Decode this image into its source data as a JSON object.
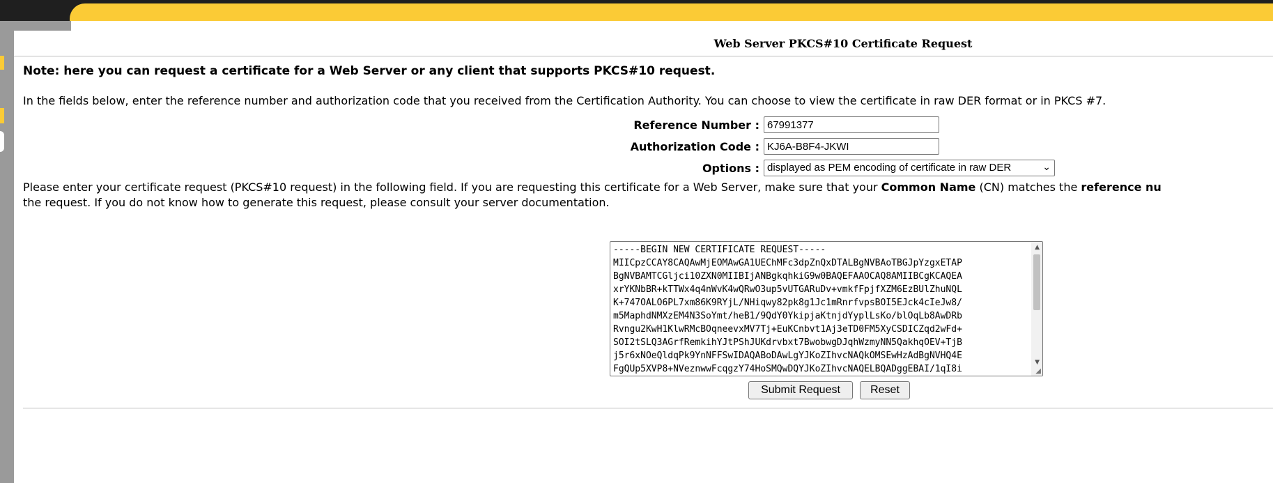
{
  "page": {
    "title": "Web Server PKCS#10 Certificate Request",
    "note": "Note: here you can request a certificate for a Web Server or any client that supports PKCS#10 request.",
    "intro": "In the fields below, enter the reference number and authorization code that you received from the Certification Authority. You can choose to view the certificate in raw DER format or in PKCS #7."
  },
  "form": {
    "reference_label": "Reference Number :",
    "reference_value": "67991377",
    "authorization_label": "Authorization Code :",
    "authorization_value": "KJ6A-B8F4-JKWI",
    "options_label": "Options :",
    "options_selected": "displayed as PEM encoding of certificate in raw DER"
  },
  "instructions": {
    "part1": "Please enter your certificate request (PKCS#10 request) in the following field. If you are requesting this certificate for a Web Server, make sure that your ",
    "bold1": "Common Name",
    "part2": " (CN) matches the ",
    "bold2": "reference nu",
    "line2": "the request. If you do not know how to generate this request, please consult your server documentation."
  },
  "request_text": "-----BEGIN NEW CERTIFICATE REQUEST-----\nMIICpzCCAY8CAQAwMjEOMAwGA1UEChMFc3dpZnQxDTALBgNVBAoTBGJpYzgxETAP\nBgNVBAMTCGljci10ZXN0MIIBIjANBgkqhkiG9w0BAQEFAAOCAQ8AMIIBCgKCAQEA\nxrYKNbBR+kTTWx4q4nWvK4wQRwO3up5vUTGARuDv+vmkfFpjfXZM6EzBUlZhuNQL\nK+747OALO6PL7xm86K9RYjL/NHiqwy82pk8g1Jc1mRnrfvpsBOI5EJck4cIeJw8/\nm5MaphdNMXzEM4N3SoYmt/heB1/9QdY0YkipjaKtnjdYyplLsKo/blOqLb8AwDRb\nRvngu2KwH1KlwRMcBOqneevxMV7Tj+EuKCnbvt1Aj3eTD0FM5XyCSDICZqd2wFd+\nSOI2tSLQ3AGrfRemkihYJtPShJUKdrvbxt7BwobwgDJqhWzmyNN5QakhqOEV+TjB\nj5r6xNOeQldqPk9YnNFFSwIDAQABoDAwLgYJKoZIhvcNAQkOMSEwHzAdBgNVHQ4E\nFgQUp5XVP8+NVeznwwFcqgzY74HoSMQwDQYJKoZIhvcNAQELBQADggEBAI/1qI8i",
  "buttons": {
    "submit": "Submit Request",
    "reset": "Reset"
  },
  "colors": {
    "header_yellow": "#fbcb36",
    "header_black": "#1f1f1f",
    "rail_gray": "#9a9a9a"
  }
}
